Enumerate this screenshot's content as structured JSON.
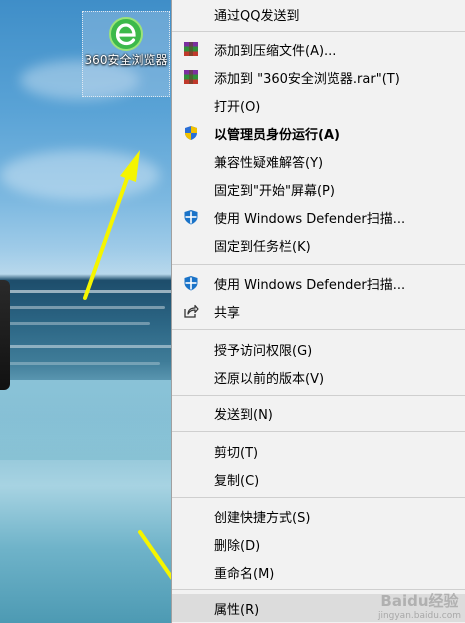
{
  "desktop_icon": {
    "label": "360安全浏览器",
    "icon": "360-browser-icon"
  },
  "context_menu": {
    "items": [
      {
        "label": "通过QQ发送到",
        "icon": "",
        "bold": false
      },
      {
        "label": "添加到压缩文件(A)...",
        "icon": "winrar-icon",
        "bold": false
      },
      {
        "label": "添加到 \"360安全浏览器.rar\"(T)",
        "icon": "winrar-icon",
        "bold": false
      },
      {
        "label": "打开(O)",
        "icon": "",
        "bold": false
      },
      {
        "label": "以管理员身份运行(A)",
        "icon": "uac-shield-icon",
        "bold": true
      },
      {
        "label": "兼容性疑难解答(Y)",
        "icon": "",
        "bold": false
      },
      {
        "label": "固定到\"开始\"屏幕(P)",
        "icon": "",
        "bold": false
      },
      {
        "label": "使用 Windows Defender扫描...",
        "icon": "defender-shield-icon",
        "bold": false
      },
      {
        "label": "固定到任务栏(K)",
        "icon": "",
        "bold": false
      },
      {
        "label": "使用 Windows Defender扫描...",
        "icon": "defender-shield-icon",
        "bold": false
      },
      {
        "label": "共享",
        "icon": "share-icon",
        "bold": false
      },
      {
        "label": "授予访问权限(G)",
        "icon": "",
        "bold": false
      },
      {
        "label": "还原以前的版本(V)",
        "icon": "",
        "bold": false
      },
      {
        "label": "发送到(N)",
        "icon": "",
        "bold": false
      },
      {
        "label": "剪切(T)",
        "icon": "",
        "bold": false
      },
      {
        "label": "复制(C)",
        "icon": "",
        "bold": false
      },
      {
        "label": "创建快捷方式(S)",
        "icon": "",
        "bold": false
      },
      {
        "label": "删除(D)",
        "icon": "",
        "bold": false
      },
      {
        "label": "重命名(M)",
        "icon": "",
        "bold": false
      },
      {
        "label": "属性(R)",
        "icon": "",
        "bold": false,
        "highlighted": true
      }
    ]
  },
  "watermark": {
    "logo": "Baidu经验",
    "url": "jingyan.baidu.com"
  },
  "colors": {
    "menu_bg": "#f2f2f2",
    "highlight": "#dcdcdc",
    "arrow": "#f5f500",
    "defender_blue": "#1a73c8"
  }
}
